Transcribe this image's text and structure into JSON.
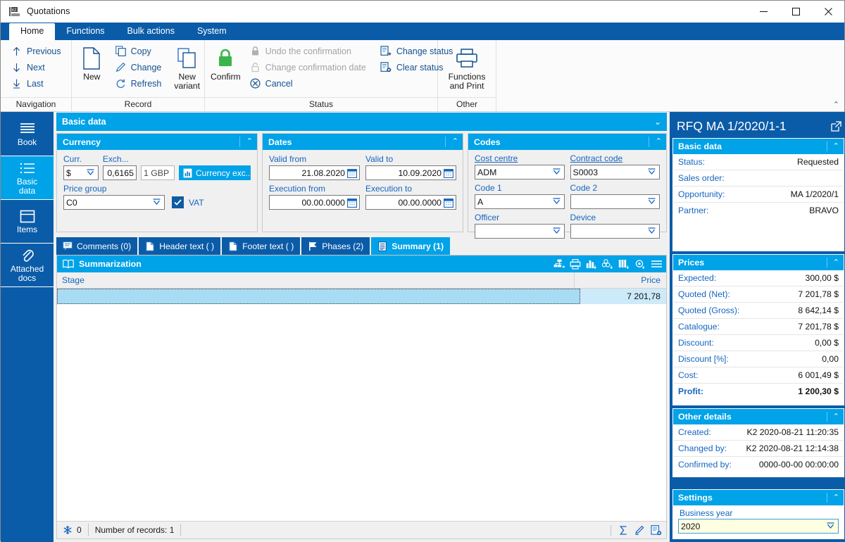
{
  "window": {
    "title": "Quotations",
    "minimize": "—",
    "maximize": "☐",
    "close": "✕"
  },
  "ribbon": {
    "tabs": [
      {
        "label": "Home",
        "active": true
      },
      {
        "label": "Functions",
        "active": false
      },
      {
        "label": "Bulk actions",
        "active": false
      },
      {
        "label": "System",
        "active": false
      }
    ],
    "groups": [
      {
        "title": "Navigation",
        "items": [
          {
            "label": "Previous",
            "icon": "arrow-up-icon"
          },
          {
            "label": "Next",
            "icon": "arrow-down-icon"
          },
          {
            "label": "Last",
            "icon": "arrow-down-bar-icon"
          }
        ]
      },
      {
        "title": "Record",
        "items": [
          {
            "label": "New",
            "icon": "new-document-icon"
          },
          {
            "label": "Copy",
            "icon": "copy-icon"
          },
          {
            "label": "Change",
            "icon": "pencil-icon"
          },
          {
            "label": "Refresh",
            "icon": "refresh-icon"
          },
          {
            "label": "New variant",
            "icon": "new-variant-icon"
          }
        ]
      },
      {
        "title": "Status",
        "items": [
          {
            "label": "Confirm",
            "icon": "lock-green-icon"
          },
          {
            "label": "Undo the confirmation",
            "icon": "lock-grey-icon",
            "disabled": true
          },
          {
            "label": "Change confirmation date",
            "icon": "lock-open-grey-icon",
            "disabled": true
          },
          {
            "label": "Cancel",
            "icon": "cancel-circle-icon"
          },
          {
            "label": "Change status",
            "icon": "change-status-icon"
          },
          {
            "label": "Clear status",
            "icon": "clear-status-icon"
          }
        ]
      },
      {
        "title": "Other",
        "items": [
          {
            "label": "Functions and Print",
            "icon": "printer-icon"
          }
        ]
      }
    ],
    "collapse_chevron": "⌃"
  },
  "sidebar": {
    "items": [
      {
        "label": "Book",
        "icon": "book-lines-icon",
        "active": false
      },
      {
        "label": "Basic\ndata",
        "line1": "Basic",
        "line2": "data",
        "icon": "list-icon",
        "active": true
      },
      {
        "label": "Items",
        "icon": "box-icon",
        "active": false
      },
      {
        "label": "Attached docs",
        "line1": "Attached",
        "line2": "docs",
        "icon": "paperclip-icon",
        "active": false
      }
    ]
  },
  "main": {
    "section_title": "Basic data",
    "section_chevron": "⌄",
    "currency": {
      "title": "Currency",
      "chevron": "⌃",
      "curr_label": "Curr.",
      "curr_value": "$",
      "exch_label": "Exch...",
      "exch_value": "0,6165",
      "exch_unit": "1 GBP",
      "exchange_button": "Currency exc...",
      "price_group_label": "Price group",
      "price_group_value": "C0",
      "vat_label": "VAT",
      "vat_checked": true
    },
    "dates": {
      "title": "Dates",
      "chevron": "⌃",
      "valid_from_label": "Valid from",
      "valid_from_value": "21.08.2020",
      "valid_to_label": "Valid to",
      "valid_to_value": "10.09.2020",
      "execution_from_label": "Execution from",
      "execution_from_value": "00.00.0000",
      "execution_to_label": "Execution to",
      "execution_to_value": "00.00.0000"
    },
    "codes": {
      "title": "Codes",
      "chevron": "⌃",
      "cost_centre_label": "Cost centre",
      "cost_centre_value": "ADM",
      "contract_code_label": "Contract code",
      "contract_code_value": "S0003",
      "code1_label": "Code 1",
      "code1_value": "A",
      "code2_label": "Code 2",
      "code2_value": "",
      "officer_label": "Officer",
      "officer_value": "",
      "device_label": "Device",
      "device_value": ""
    },
    "doc_tabs": [
      {
        "label": "Comments (0)",
        "icon": "comment-icon",
        "active": false
      },
      {
        "label": "Header text ( )",
        "icon": "document-icon",
        "active": false
      },
      {
        "label": "Footer text ( )",
        "icon": "document-icon",
        "active": false
      },
      {
        "label": "Phases (2)",
        "icon": "flag-icon",
        "active": false
      },
      {
        "label": "Summary (1)",
        "icon": "summary-icon",
        "active": true
      }
    ],
    "grid": {
      "title": "Summarization",
      "title_icon": "book-open-icon",
      "tools": [
        {
          "name": "hierarchy-icon"
        },
        {
          "name": "print-icon"
        },
        {
          "name": "chart-bar-icon"
        },
        {
          "name": "group-icon"
        },
        {
          "name": "columns-icon"
        },
        {
          "name": "settings-gear-icon"
        },
        {
          "name": "menu-icon"
        }
      ],
      "columns": [
        "Stage",
        "Price"
      ],
      "rows": [
        {
          "stage": "",
          "price": "7 201,78"
        }
      ],
      "status": {
        "flake_count": "0",
        "records_text": "Number of records: 1",
        "sum_icon": "sigma-icon",
        "edit_icon": "pencil-icon",
        "add_record_icon": "add-record-icon"
      }
    }
  },
  "rightpanel": {
    "title": "RFQ  MA 1/2020/1-1",
    "external_icon": "external-link-icon",
    "basic": {
      "title": "Basic data",
      "chevron": "⌃",
      "rows": [
        {
          "key": "Status:",
          "value": "Requested"
        },
        {
          "key": "Sales order:",
          "value": ""
        },
        {
          "key": "Opportunity:",
          "value": "MA 1/2020/1"
        },
        {
          "key": "Partner:",
          "value": "BRAVO"
        }
      ]
    },
    "prices": {
      "title": "Prices",
      "chevron": "⌃",
      "rows": [
        {
          "key": "Expected:",
          "value": "300,00 $",
          "bold": false
        },
        {
          "key": "Quoted (Net):",
          "value": "7 201,78 $",
          "bold": false
        },
        {
          "key": "Quoted (Gross):",
          "value": "8 642,14 $",
          "bold": false
        },
        {
          "key": "Catalogue:",
          "value": "7 201,78 $",
          "bold": false
        },
        {
          "key": "Discount:",
          "value": "0,00 $",
          "bold": false
        },
        {
          "key": "Discount [%]:",
          "value": "0,00",
          "bold": false
        },
        {
          "key": "Cost:",
          "value": "6 001,49 $",
          "bold": false
        },
        {
          "key": "Profit:",
          "value": "1 200,30 $",
          "bold": true
        }
      ]
    },
    "other": {
      "title": "Other details",
      "chevron": "⌃",
      "rows": [
        {
          "key": "Created:",
          "value": "K2 2020-08-21 11:20:35"
        },
        {
          "key": "Changed by:",
          "value": "K2 2020-08-21 12:14:38"
        },
        {
          "key": "Confirmed by:",
          "value": "0000-00-00 00:00:00"
        }
      ]
    },
    "settings": {
      "title": "Settings",
      "chevron": "⌃",
      "business_year_label": "Business year",
      "business_year_value": "2020"
    }
  },
  "colors": {
    "ribbon_blue": "#0b5ca8",
    "accent_cyan": "#00a2e8",
    "label_blue": "#1565c0",
    "row_select": "#a8dcf5",
    "confirm_green": "#3cb44a"
  }
}
